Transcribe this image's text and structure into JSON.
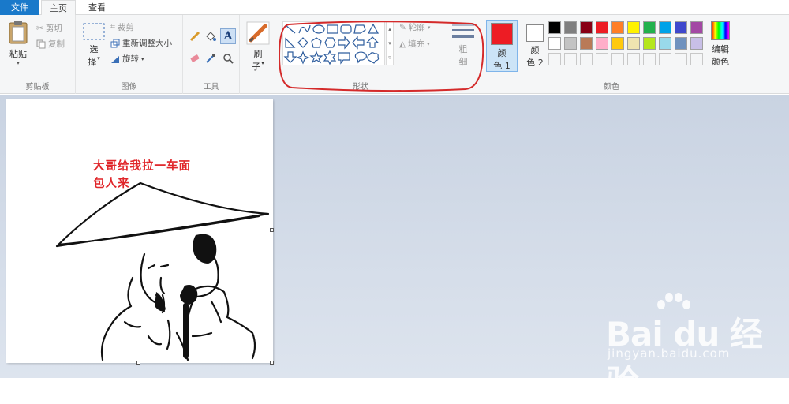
{
  "tabs": {
    "file": "文件",
    "home": "主页",
    "view": "查看"
  },
  "clipboard": {
    "paste": "粘贴",
    "cut": "剪切",
    "copy": "复制",
    "label": "剪贴板"
  },
  "image": {
    "select_line1": "选",
    "select_line2": "择",
    "crop": "裁剪",
    "resize": "重新调整大小",
    "rotate": "旋转",
    "label": "图像"
  },
  "tools": {
    "label": "工具"
  },
  "brush": {
    "line1": "刷",
    "line2": "子"
  },
  "shapes": {
    "outline": "轮廓",
    "fill": "填充",
    "label": "形状"
  },
  "size": {
    "line1": "粗",
    "line2": "细"
  },
  "colors": {
    "color1_line1": "颜",
    "color1_line2": "色 1",
    "color2_line1": "颜",
    "color2_line2": "色 2",
    "edit_line1": "编辑",
    "edit_line2": "颜色",
    "label": "颜色",
    "color1": "#ed1c24",
    "color2": "#ffffff",
    "palette_row1": [
      "#000000",
      "#7f7f7f",
      "#880015",
      "#ed1c24",
      "#ff7f27",
      "#fff200",
      "#22b14c",
      "#00a2e8",
      "#3f48cc",
      "#a349a4"
    ],
    "palette_row2": [
      "#ffffff",
      "#c3c3c3",
      "#b97a57",
      "#ffaec9",
      "#ffc90e",
      "#efe4b0",
      "#b5e61d",
      "#99d9ea",
      "#7092be",
      "#c8bfe7"
    ]
  },
  "canvas": {
    "caption_line1": "大哥给我拉一车面",
    "caption_line2": "包人来"
  },
  "watermark": {
    "logo": "Bai du 经验",
    "url": "jingyan.baidu.com"
  }
}
